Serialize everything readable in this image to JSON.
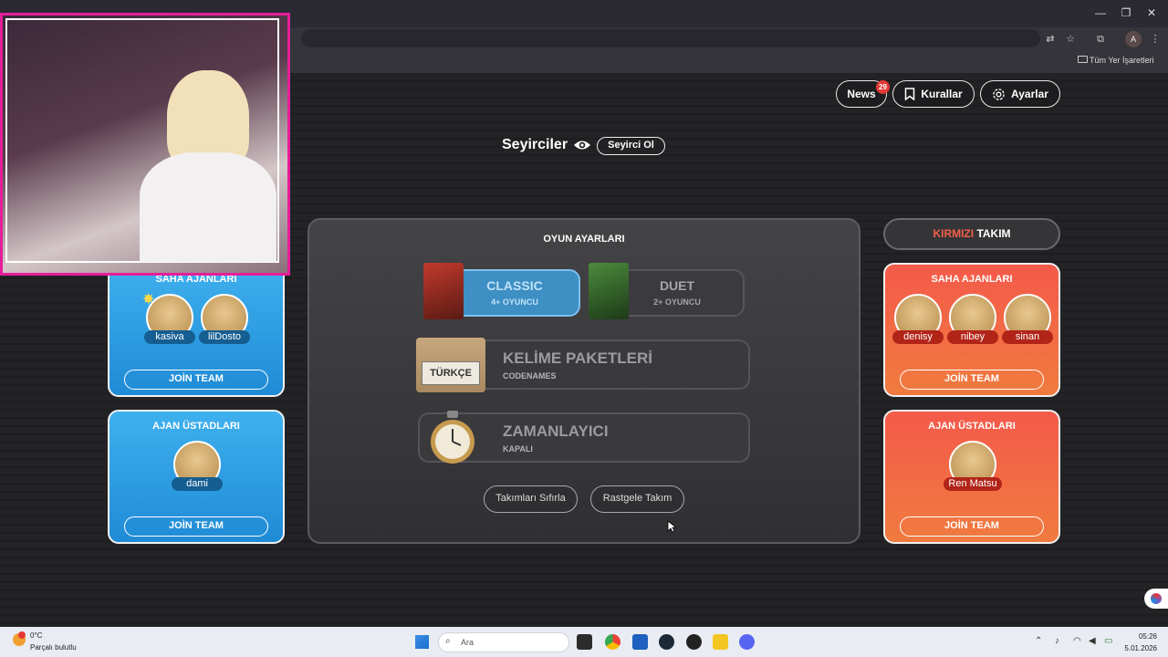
{
  "browser": {
    "bookmarks_label": "Tüm Yer İşaretleri",
    "profile_initial": "A"
  },
  "header": {
    "news_label": "News",
    "news_badge": "29",
    "rules_label": "Kurallar",
    "settings_label": "Ayarlar"
  },
  "spectators": {
    "title": "Seyirciler",
    "button": "Seyirci Ol"
  },
  "game_settings": {
    "title": "OYUN AYARLARI",
    "modes": [
      {
        "title": "CLASSIC",
        "subtitle": "4+ OYUNCU",
        "selected": true
      },
      {
        "title": "DUET",
        "subtitle": "2+ OYUNCU",
        "selected": false
      }
    ],
    "word_packs": {
      "title": "KELİME PAKETLERİ",
      "subtitle": "CODENAMES",
      "badge": "TÜRKÇE"
    },
    "timer": {
      "title": "ZAMANLAYICI",
      "subtitle": "KAPALI"
    },
    "reset_teams": "Takımları Sıfırla",
    "random_team": "Rastgele Takım"
  },
  "blue_team": {
    "operatives_title": "SAHA AJANLARI",
    "operatives": [
      "kasiva",
      "lilDosto"
    ],
    "spymasters_title": "AJAN ÜSTADLARI",
    "spymasters": [
      "dami"
    ],
    "join_label": "JOİN TEAM"
  },
  "red_team": {
    "header_colored": "KIRMIZI",
    "header_rest": " TAKIM",
    "operatives_title": "SAHA AJANLARI",
    "operatives": [
      "denisy",
      "nibey",
      "sinan"
    ],
    "spymasters_title": "AJAN ÜSTADLARI",
    "spymasters": [
      "Ren Matsu"
    ],
    "join_label": "JOİN TEAM"
  },
  "taskbar": {
    "weather_temp": "0°C",
    "weather_sub": "Parçalı bulutlu",
    "search_placeholder": "Ara",
    "time": "05:26",
    "date": "5.01.2026"
  },
  "colors": {
    "blue_team": "#2a9ee6",
    "red_team": "#f2604a",
    "classic_selected": "#3d8fc4",
    "webcam_border": "#e51e9a"
  }
}
